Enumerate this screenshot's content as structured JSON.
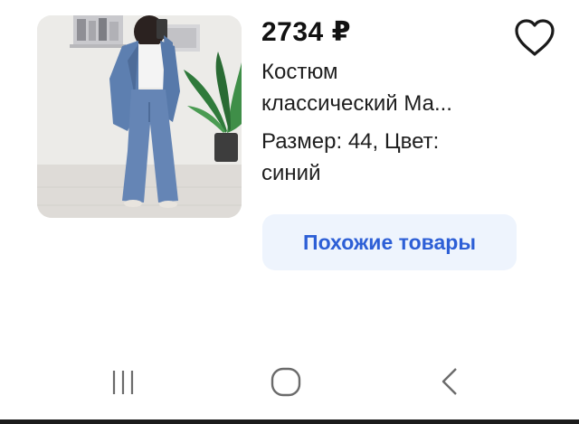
{
  "product": {
    "price": "2734 ₽",
    "title_line1": "Костюм",
    "title_line2": "классический Ма...",
    "meta_line1": "Размер: 44, Цвет:",
    "meta_line2": "синий",
    "image_icon": "product-photo"
  },
  "actions": {
    "favorite_icon": "heart-outline-icon",
    "similar_button_label": "Похожие товары"
  },
  "navbar": {
    "recent_icon": "recent-apps-icon",
    "home_icon": "home-icon",
    "back_icon": "back-icon"
  },
  "colors": {
    "accent": "#2d5fd6",
    "button_bg": "#eef4fd",
    "text": "#1e1e1e"
  }
}
